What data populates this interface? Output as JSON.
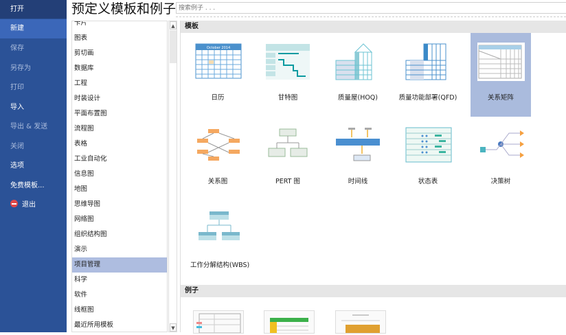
{
  "sidebar": {
    "items": [
      {
        "label": "打开",
        "state": "normal"
      },
      {
        "label": "新建",
        "state": "selected"
      },
      {
        "label": "保存",
        "state": "dim"
      },
      {
        "label": "另存为",
        "state": "dim"
      },
      {
        "label": "打印",
        "state": "dim"
      },
      {
        "label": "导入",
        "state": "normal"
      },
      {
        "label": "导出 & 发送",
        "state": "dim"
      },
      {
        "label": "关闭",
        "state": "dim"
      },
      {
        "label": "选项",
        "state": "normal"
      },
      {
        "label": "免费模板...",
        "state": "normal"
      },
      {
        "label": "退出",
        "state": "normal"
      }
    ]
  },
  "header": {
    "title": "预定义模板和例子",
    "search_placeholder": "搜索例子 . . ."
  },
  "categories": [
    "卡片",
    "图表",
    "剪切画",
    "数据库",
    "工程",
    "时装设计",
    "平面布置图",
    "流程图",
    "表格",
    "工业自动化",
    "信息图",
    "地图",
    "思维导图",
    "网络图",
    "组织结构图",
    "演示",
    "项目管理",
    "科学",
    "软件",
    "线框图",
    "最近所用模板"
  ],
  "selected_category": "项目管理",
  "templates_section": {
    "title": "模板",
    "items": [
      "日历",
      "甘特图",
      "质量屋(HOQ)",
      "质量功能部署(QFD)",
      "关系矩阵",
      "关系图",
      "PERT 图",
      "时间线",
      "状态表",
      "决策树",
      "工作分解结构(WBS)"
    ],
    "selected": "关系矩阵",
    "calendar_caption": "October 2014"
  },
  "examples_section": {
    "title": "例子"
  },
  "colors": {
    "sidebar": "#2b5297",
    "sidebar_selected": "#3b67b9",
    "selection": "#aabbdd"
  }
}
